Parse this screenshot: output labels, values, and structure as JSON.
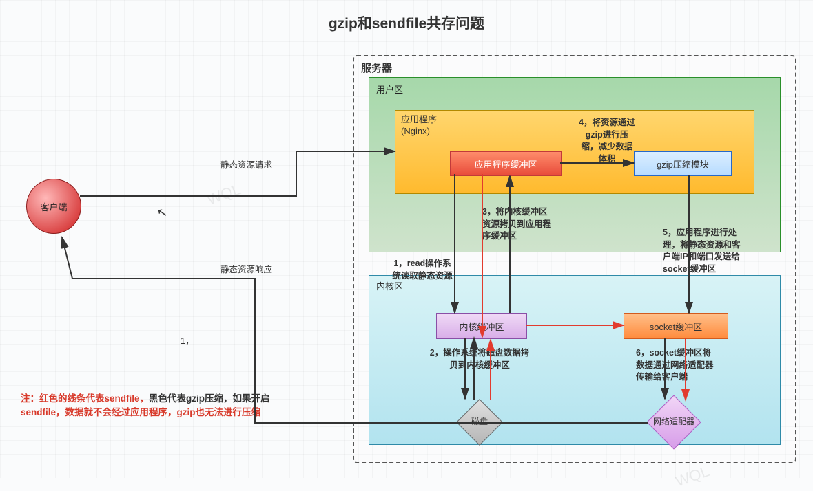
{
  "title": "gzip和sendfile共存问题",
  "client": {
    "label": "客户端"
  },
  "server": {
    "label": "服务器"
  },
  "userArea": {
    "label": "用户区"
  },
  "app": {
    "label_line1": "应用程序",
    "label_line2": "(Nginx)",
    "buffer": "应用程序缓冲区",
    "gzip_module": "gzip压缩模块"
  },
  "kernelArea": {
    "label": "内核区"
  },
  "kernel": {
    "buffer": "内核缓冲区",
    "socket_buffer": "socket缓冲区",
    "disk": "磁盘",
    "network_adapter": "网络适配器"
  },
  "edges": {
    "request": "静态资源请求",
    "response": "静态资源响应"
  },
  "steps": {
    "s1": "1，read操作系\n统读取静态资源",
    "s2": "2，操作系统将磁盘数据拷\n贝到内核缓冲区",
    "s3": "3，将内核缓冲区\n资源拷贝到应用程\n序缓冲区",
    "s4": "4，将资源通过\ngzip进行压\n缩，减少数据\n体积",
    "s5": "5，应用程序进行处\n理，将静态资源和客\n户端IP和端口发送给\nsocket缓冲区",
    "s6": "6，socket缓冲区将\n数据通过网络适配器\n传输给客户端",
    "s_numref": "1，"
  },
  "note": {
    "prefix": "注：",
    "red1": "红色的线条代表sendfile，",
    "black1": "黑色代表gzip压缩，如果开启",
    "red2": "sendfile，数据就不会经过应用程序，gzip也无法进行压缩"
  },
  "watermark": "WQL"
}
